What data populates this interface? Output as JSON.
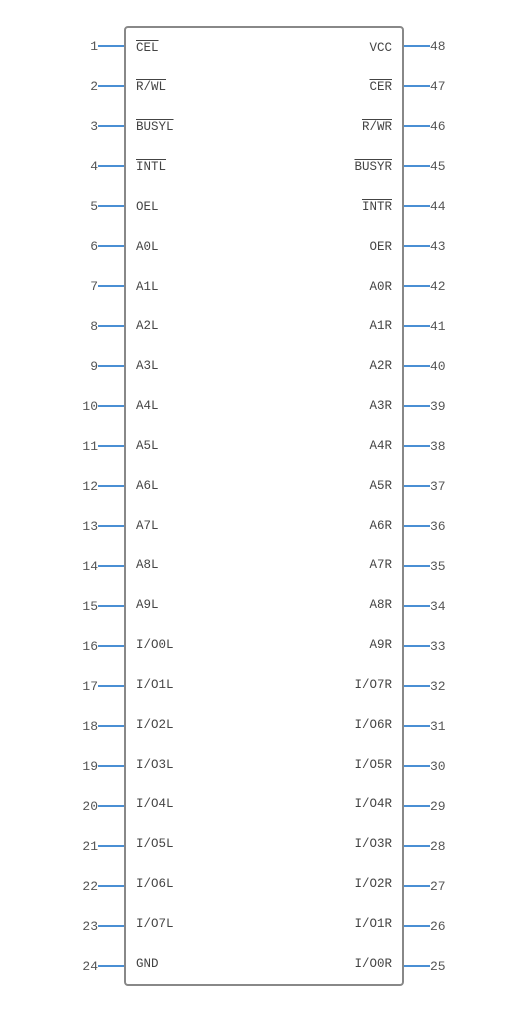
{
  "left_pins": [
    {
      "num": "1",
      "label": "CEL",
      "overline": true
    },
    {
      "num": "2",
      "label": "R/WL",
      "overline": true
    },
    {
      "num": "3",
      "label": "BUSYL",
      "overline": true
    },
    {
      "num": "4",
      "label": "INTL",
      "overline": true
    },
    {
      "num": "5",
      "label": "OEL",
      "overline": false
    },
    {
      "num": "6",
      "label": "A0L",
      "overline": false
    },
    {
      "num": "7",
      "label": "A1L",
      "overline": false
    },
    {
      "num": "8",
      "label": "A2L",
      "overline": false
    },
    {
      "num": "9",
      "label": "A3L",
      "overline": false
    },
    {
      "num": "10",
      "label": "A4L",
      "overline": false
    },
    {
      "num": "11",
      "label": "A5L",
      "overline": false
    },
    {
      "num": "12",
      "label": "A6L",
      "overline": false
    },
    {
      "num": "13",
      "label": "A7L",
      "overline": false
    },
    {
      "num": "14",
      "label": "A8L",
      "overline": false
    },
    {
      "num": "15",
      "label": "A9L",
      "overline": false
    },
    {
      "num": "16",
      "label": "I/O0L",
      "overline": false
    },
    {
      "num": "17",
      "label": "I/O1L",
      "overline": false
    },
    {
      "num": "18",
      "label": "I/O2L",
      "overline": false
    },
    {
      "num": "19",
      "label": "I/O3L",
      "overline": false
    },
    {
      "num": "20",
      "label": "I/O4L",
      "overline": false
    },
    {
      "num": "21",
      "label": "I/O5L",
      "overline": false
    },
    {
      "num": "22",
      "label": "I/O6L",
      "overline": false
    },
    {
      "num": "23",
      "label": "I/O7L",
      "overline": false
    },
    {
      "num": "24",
      "label": "GND",
      "overline": false
    }
  ],
  "right_pins": [
    {
      "num": "48",
      "label": "VCC",
      "overline": false
    },
    {
      "num": "47",
      "label": "CER",
      "overline": true
    },
    {
      "num": "46",
      "label": "R/WR",
      "overline": true
    },
    {
      "num": "45",
      "label": "BUSYR",
      "overline": true
    },
    {
      "num": "44",
      "label": "INTR",
      "overline": true
    },
    {
      "num": "43",
      "label": "OER",
      "overline": false
    },
    {
      "num": "42",
      "label": "A0R",
      "overline": false
    },
    {
      "num": "41",
      "label": "A1R",
      "overline": false
    },
    {
      "num": "40",
      "label": "A2R",
      "overline": false
    },
    {
      "num": "39",
      "label": "A3R",
      "overline": false
    },
    {
      "num": "38",
      "label": "A4R",
      "overline": false
    },
    {
      "num": "37",
      "label": "A5R",
      "overline": false
    },
    {
      "num": "36",
      "label": "A6R",
      "overline": false
    },
    {
      "num": "35",
      "label": "A7R",
      "overline": false
    },
    {
      "num": "34",
      "label": "A8R",
      "overline": false
    },
    {
      "num": "33",
      "label": "A9R",
      "overline": false
    },
    {
      "num": "32",
      "label": "I/O7R",
      "overline": false
    },
    {
      "num": "31",
      "label": "I/O6R",
      "overline": false
    },
    {
      "num": "30",
      "label": "I/O5R",
      "overline": false
    },
    {
      "num": "29",
      "label": "I/O4R",
      "overline": false
    },
    {
      "num": "28",
      "label": "I/O3R",
      "overline": false
    },
    {
      "num": "27",
      "label": "I/O2R",
      "overline": false
    },
    {
      "num": "26",
      "label": "I/O1R",
      "overline": false
    },
    {
      "num": "25",
      "label": "I/O0R",
      "overline": false
    }
  ]
}
